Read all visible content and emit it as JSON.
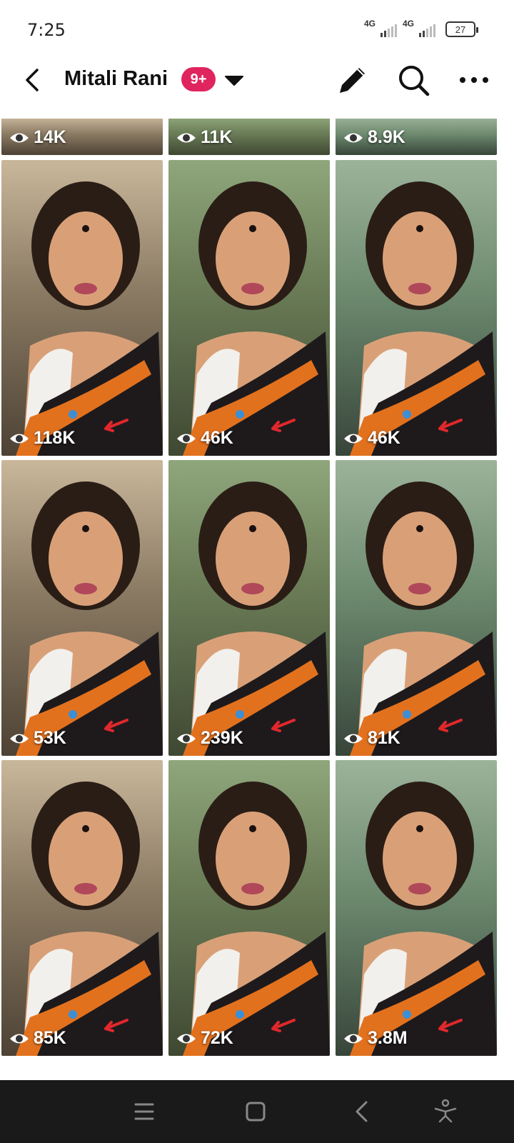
{
  "status_bar": {
    "time": "7:25",
    "network1": "4G",
    "network2": "4G",
    "battery": "27"
  },
  "header": {
    "title": "Mitali Rani",
    "badge": "9+",
    "badge_color": "#e0245e"
  },
  "icons": {
    "back": "back-arrow-icon",
    "caret": "chevron-down-icon",
    "edit": "pencil-icon",
    "search": "search-icon",
    "more": "more-horizontal-icon",
    "views": "eye-icon"
  },
  "videos": [
    {
      "views": "14K"
    },
    {
      "views": "11K"
    },
    {
      "views": "8.9K"
    },
    {
      "views": "118K"
    },
    {
      "views": "46K"
    },
    {
      "views": "46K"
    },
    {
      "views": "53K"
    },
    {
      "views": "239K"
    },
    {
      "views": "81K"
    },
    {
      "views": "85K"
    },
    {
      "views": "72K"
    },
    {
      "views": "3.8M"
    }
  ],
  "navigation": {
    "buttons": [
      "menu-icon",
      "home-square-icon",
      "back-chevron-icon",
      "accessibility-icon"
    ]
  }
}
